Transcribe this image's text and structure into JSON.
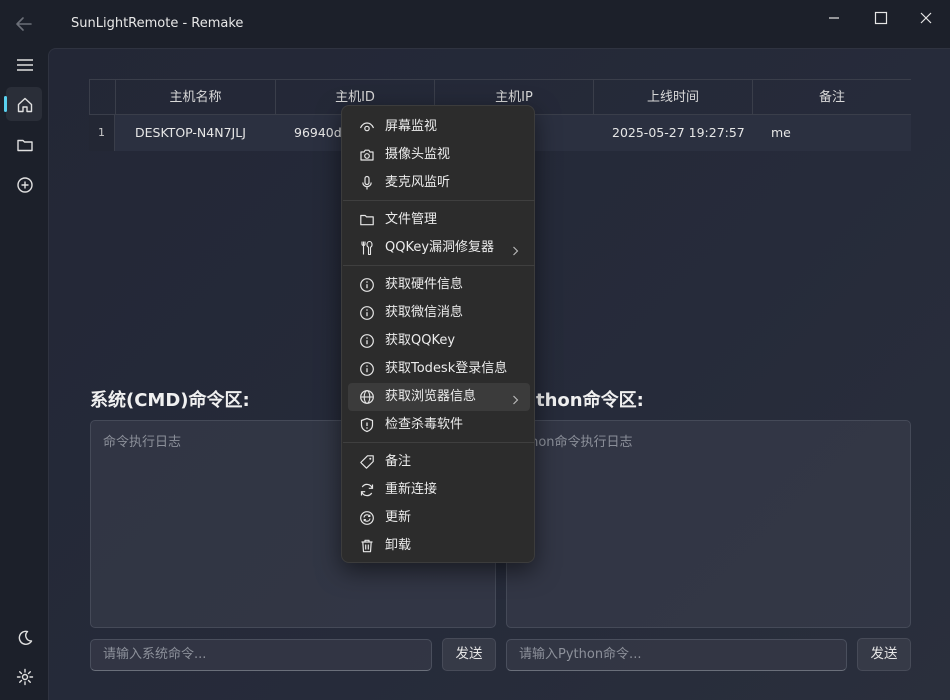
{
  "window": {
    "title": "SunLightRemote - Remake"
  },
  "table": {
    "headers": [
      "主机名称",
      "主机ID",
      "主机IP",
      "上线时间",
      "备注"
    ],
    "rows": [
      {
        "index": "1",
        "name": "DESKTOP-N4N7JLJ",
        "id": "96940d0",
        "ip": "",
        "online": "2025-05-27 19:27:57",
        "note": "me"
      }
    ]
  },
  "cmd": {
    "title": "系统(CMD)命令区:",
    "log_placeholder": "命令执行日志",
    "input_placeholder": "请输入系统命令...",
    "send": "发送"
  },
  "python": {
    "title": "thon命令区:",
    "log_placeholder": "thon命令执行日志",
    "input_placeholder": "请输入Python命令...",
    "send": "发送"
  },
  "context_menu": {
    "items": [
      {
        "label": "屏幕监视",
        "icon": "eye-icon"
      },
      {
        "label": "摄像头监视",
        "icon": "camera-icon"
      },
      {
        "label": "麦克风监听",
        "icon": "microphone-icon"
      },
      {
        "label": "文件管理",
        "icon": "folder-icon"
      },
      {
        "label": "QQKey漏洞修复器",
        "icon": "tools-icon"
      },
      {
        "label": "获取硬件信息",
        "icon": "info-icon"
      },
      {
        "label": "获取微信消息",
        "icon": "info-icon"
      },
      {
        "label": "获取QQKey",
        "icon": "info-icon"
      },
      {
        "label": "获取Todesk登录信息",
        "icon": "info-icon"
      },
      {
        "label": "获取浏览器信息",
        "icon": "globe-icon"
      },
      {
        "label": "检查杀毒软件",
        "icon": "shield-icon"
      },
      {
        "label": "备注",
        "icon": "tag-icon"
      },
      {
        "label": "重新连接",
        "icon": "reconnect-icon"
      },
      {
        "label": "更新",
        "icon": "update-icon"
      },
      {
        "label": "卸载",
        "icon": "trash-icon"
      }
    ]
  },
  "colors": {
    "accent": "#5ad1f0",
    "menu_bg": "#2c2c2c",
    "panel_bg": "#232736"
  }
}
